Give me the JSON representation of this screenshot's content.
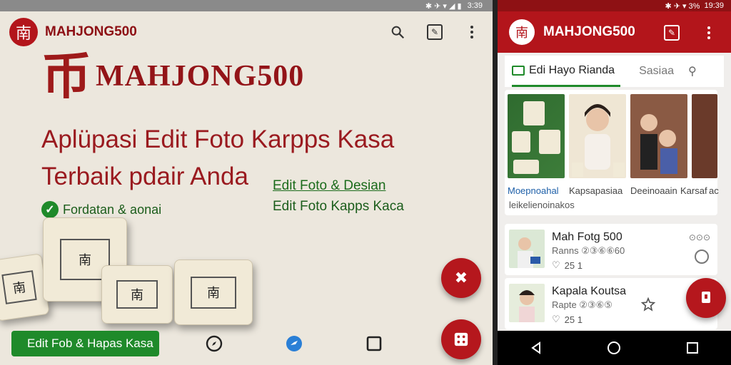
{
  "left": {
    "status_time": "3:39",
    "status_glyphs": "✱ ✈ ▾ ◢ ▮",
    "app_name": "MAHJONG500",
    "logo_glyph": "南",
    "hero_glyph": "币",
    "hero_brand": "MAHJONG500",
    "headline_line1": "Aplüpasi Edit Foto Karpps Kasa",
    "headline_line2": "Terbaik pdair Anda",
    "green_link": "Edit Foto & Desian",
    "green_sub": "Edit Foto Kapps Kaca",
    "check_label": "Fordatan & aonai",
    "bottom_button": "Edit Fob & Hapas Kasa",
    "tile_glyphs": [
      "南",
      "南",
      "南",
      "南"
    ],
    "icons": {
      "search": "search-icon",
      "edit": "edit-icon",
      "more": "more-vert-icon",
      "fab_top": "tools-icon",
      "fab_bottom": "dice-icon",
      "nav1": "compass-icon",
      "nav2": "share-icon",
      "nav3": "square-icon"
    }
  },
  "right": {
    "status_time": "19:39",
    "status_glyphs": "✱ ✈ ▾ 3%",
    "app_name": "MAHJONG500",
    "logo_glyph": "南",
    "tab_active": "Edi Hayo Rianda",
    "tab_other": "Sasiaa",
    "tab_search": "🔍",
    "thumbs": [
      {
        "label": "Moepnoahal"
      },
      {
        "label": "Kapsapasiaa"
      },
      {
        "label": "Deeinoaain"
      },
      {
        "label": "Karsaf"
      },
      {
        "label": "ac"
      }
    ],
    "card_sub": "leikelienoinakos",
    "list": [
      {
        "title": "Mah Fotg 500",
        "sub": "Ranns ②③⑥⑥60",
        "meta": "25 1",
        "dots": "⊙⊙⊙"
      },
      {
        "title": "Kapala Koutsa",
        "sub": "Rapte ②③⑥⑤",
        "meta": "25 1",
        "dots": "⊙⊙⊙"
      }
    ],
    "icons": {
      "edit": "edit-icon",
      "more": "more-vert-icon",
      "star": "star-icon",
      "fab": "share-icon",
      "back": "back-icon",
      "home": "home-icon",
      "recent": "recent-icon"
    }
  }
}
